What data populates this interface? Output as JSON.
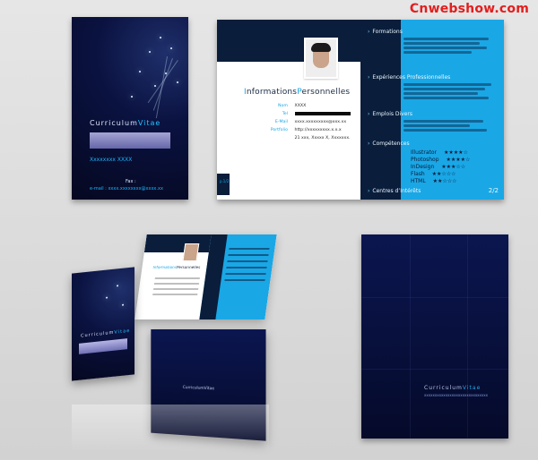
{
  "watermark": "Cnwebshow.com",
  "cover": {
    "title_left": "Curriculum",
    "title_right": "Vitae",
    "name_line": "Xxxxxxxx XXXX",
    "email_label": "Fax :",
    "email_value": "e-mail : xxxx.xxxxxxxx@xxxx.xx"
  },
  "spread": {
    "informations_title_left": "I",
    "informations_title_mid": "nformations",
    "informations_title_right_initial": "P",
    "informations_title_right": "ersonnelles",
    "info_lines": [
      {
        "k": "Nom",
        "v": "XXXX"
      },
      {
        "k": "Tel",
        "v": ""
      },
      {
        "k": "E-Mail",
        "v": "xxxx.xxxxxxxxx@xxx.xx"
      },
      {
        "k": "Portfolio",
        "v": "http://xxxxxxxxx.x.x.x"
      },
      {
        "k": "",
        "v": "21 xxx, Xxxxx X, Xxxxxxx."
      }
    ],
    "page_left": "p.1/2",
    "right_sections": [
      {
        "label": "Formations"
      },
      {
        "label": "Expériences Professionnelles"
      },
      {
        "label": "Emplois Divers"
      },
      {
        "label": "Compétences"
      },
      {
        "label": "Centres d’Intérêts"
      }
    ],
    "stars_rows": [
      {
        "name": "Illustrator",
        "stars": "★★★★☆"
      },
      {
        "name": "Photoshop",
        "stars": "★★★★☆"
      },
      {
        "name": "InDesign",
        "stars": "★★★☆☆"
      },
      {
        "name": "Flash",
        "stars": "★★☆☆☆"
      },
      {
        "name": "HTML",
        "stars": "★★☆☆☆"
      }
    ],
    "page_right": "2/2"
  },
  "back": {
    "title_left": "Curriculum",
    "title_right": "Vitae",
    "subtitle": "xxxxxxxxxxxxxxxxxxxxxxxxxxxxxx"
  },
  "mockups": {
    "cover_title_left": "Curriculum",
    "cover_title_right": "Vitae",
    "spread_title_left": "Informations",
    "spread_title_right": "Personnelles",
    "folded_title": "CurriculumVitae"
  }
}
